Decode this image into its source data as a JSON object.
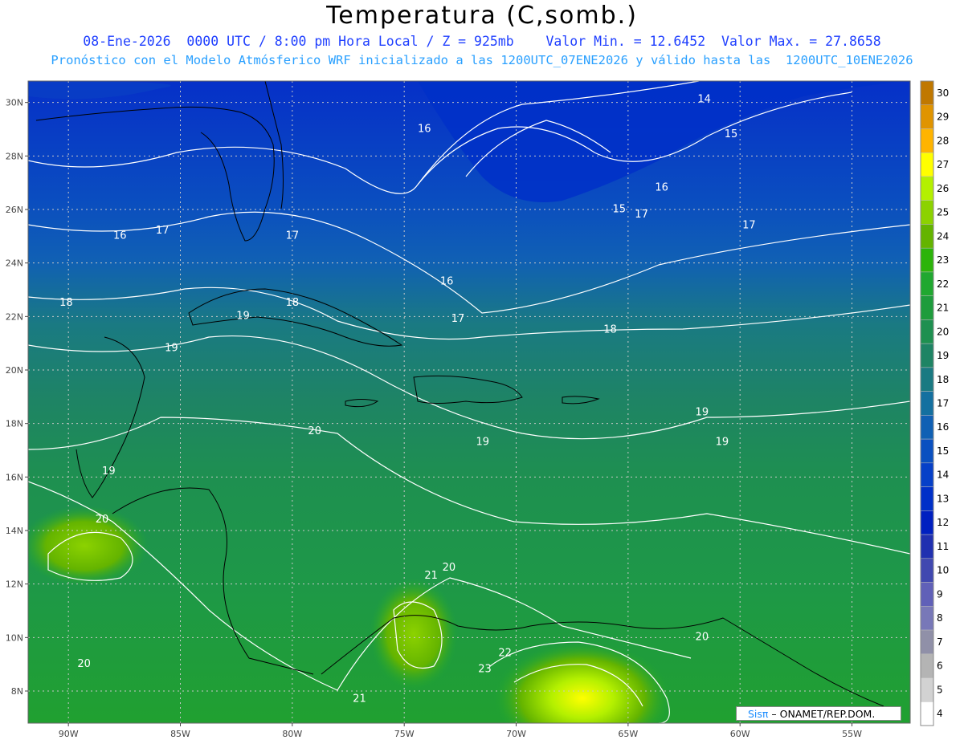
{
  "title": "Temperatura (C,somb.)",
  "subtitle_1": "08-Ene-2026  0000 UTC / 8:00 pm Hora Local / Z = 925mb    Valor Min. = 12.6452  Valor Max. = 27.8658",
  "subtitle_2": "Pronóstico con el Modelo Atmósferico WRF inicializado a las 1200UTC_07ENE2026 y válido hasta las  1200UTC_10ENE2026",
  "credit": {
    "brand": "Sisπ",
    "text": " – ONAMET/REP.DOM."
  },
  "axes": {
    "lat_labels": [
      "30N",
      "28N",
      "26N",
      "24N",
      "22N",
      "20N",
      "18N",
      "16N",
      "14N",
      "12N",
      "10N",
      "8N"
    ],
    "lon_labels": [
      "90W",
      "85W",
      "80W",
      "75W",
      "70W",
      "65W",
      "60W",
      "55W"
    ]
  },
  "colorbar": {
    "levels": [
      "30",
      "29",
      "28",
      "27",
      "26",
      "25",
      "24",
      "23",
      "22",
      "21",
      "20",
      "19",
      "18",
      "17",
      "16",
      "15",
      "14",
      "13",
      "12",
      "11",
      "10",
      "9",
      "8",
      "7",
      "6",
      "5",
      "4"
    ],
    "colors": [
      "#c07800",
      "#e09400",
      "#ffb400",
      "#ffff00",
      "#b4f000",
      "#8cd200",
      "#64b400",
      "#2cb40a",
      "#20a830",
      "#1e9c3c",
      "#1e9050",
      "#1e8464",
      "#1a7a82",
      "#1470a0",
      "#1060b4",
      "#0a50c0",
      "#0640c8",
      "#0030c8",
      "#0020c0",
      "#2030b0",
      "#4048b0",
      "#6060b8",
      "#7878b8",
      "#9090a8",
      "#b4b4b4",
      "#d2d2d2",
      "#ffffff"
    ]
  },
  "contour_labels": [
    {
      "text": "14",
      "lon": -61.6,
      "lat": 30.0
    },
    {
      "text": "15",
      "lon": -60.4,
      "lat": 28.7
    },
    {
      "text": "16",
      "lon": -74.1,
      "lat": 28.9
    },
    {
      "text": "16",
      "lon": -63.5,
      "lat": 26.7
    },
    {
      "text": "15",
      "lon": -65.4,
      "lat": 25.9
    },
    {
      "text": "17",
      "lon": -64.4,
      "lat": 25.7
    },
    {
      "text": "17",
      "lon": -59.6,
      "lat": 25.3
    },
    {
      "text": "16",
      "lon": -87.7,
      "lat": 24.9
    },
    {
      "text": "17",
      "lon": -85.8,
      "lat": 25.1
    },
    {
      "text": "17",
      "lon": -80.0,
      "lat": 24.9
    },
    {
      "text": "16",
      "lon": -73.1,
      "lat": 23.2
    },
    {
      "text": "17",
      "lon": -72.6,
      "lat": 21.8
    },
    {
      "text": "18",
      "lon": -90.1,
      "lat": 22.4
    },
    {
      "text": "18",
      "lon": -80.0,
      "lat": 22.4
    },
    {
      "text": "19",
      "lon": -82.2,
      "lat": 21.9
    },
    {
      "text": "18",
      "lon": -65.8,
      "lat": 21.4
    },
    {
      "text": "19",
      "lon": -85.4,
      "lat": 20.7
    },
    {
      "text": "19",
      "lon": -61.7,
      "lat": 18.3
    },
    {
      "text": "20",
      "lon": -79.0,
      "lat": 17.6
    },
    {
      "text": "19",
      "lon": -71.5,
      "lat": 17.2
    },
    {
      "text": "19",
      "lon": -60.8,
      "lat": 17.2
    },
    {
      "text": "19",
      "lon": -88.2,
      "lat": 16.1
    },
    {
      "text": "20",
      "lon": -88.5,
      "lat": 14.3
    },
    {
      "text": "21",
      "lon": -73.8,
      "lat": 12.2
    },
    {
      "text": "20",
      "lon": -73.0,
      "lat": 12.5
    },
    {
      "text": "22",
      "lon": -70.5,
      "lat": 9.3
    },
    {
      "text": "23",
      "lon": -71.4,
      "lat": 8.7
    },
    {
      "text": "20",
      "lon": -61.7,
      "lat": 9.9
    },
    {
      "text": "20",
      "lon": -89.3,
      "lat": 8.9
    },
    {
      "text": "21",
      "lon": -77.0,
      "lat": 7.6
    }
  ]
}
